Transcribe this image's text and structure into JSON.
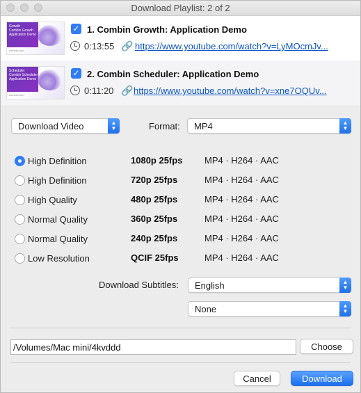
{
  "window": {
    "title": "Download Playlist: 2 of 2"
  },
  "playlist": [
    {
      "thumb_caption": "Growth",
      "thumb_text": "Combin Growth Application Demo",
      "thumb_site": "combin.com",
      "checked": true,
      "title": "1. Combin Growth: Application Demo",
      "duration": "0:13:55",
      "url": "https://www.youtube.com/watch?v=LyMOcmJv..."
    },
    {
      "thumb_caption": "Scheduler",
      "thumb_text": "Combin Scheduler Application Demo",
      "thumb_site": "combin.com",
      "checked": true,
      "title": "2. Combin Scheduler: Application Demo",
      "duration": "0:11:20",
      "url": "https://www.youtube.com/watch?v=xne7OQUv..."
    }
  ],
  "options": {
    "mode": "Download Video",
    "format_label": "Format:",
    "format": "MP4"
  },
  "qualities": [
    {
      "label": "High Definition",
      "resolution": "1080p 25fps",
      "codec": "MP4 · H264 · AAC",
      "selected": true
    },
    {
      "label": "High Definition",
      "resolution": "720p 25fps",
      "codec": "MP4 · H264 · AAC",
      "selected": false
    },
    {
      "label": "High Quality",
      "resolution": "480p 25fps",
      "codec": "MP4 · H264 · AAC",
      "selected": false
    },
    {
      "label": "Normal Quality",
      "resolution": "360p 25fps",
      "codec": "MP4 · H264 · AAC",
      "selected": false
    },
    {
      "label": "Normal Quality",
      "resolution": "240p 25fps",
      "codec": "MP4 · H264 · AAC",
      "selected": false
    },
    {
      "label": "Low Resolution",
      "resolution": "QCIF 25fps",
      "codec": "MP4 · H264 · AAC",
      "selected": false
    }
  ],
  "subtitles": {
    "label": "Download Subtitles:",
    "language": "English",
    "secondary": "None"
  },
  "destination": {
    "path": "/Volumes/Mac mini/4kvddd",
    "choose_label": "Choose"
  },
  "footer": {
    "cancel_label": "Cancel",
    "download_label": "Download"
  },
  "colors": {
    "accent": "#2e7cf6",
    "link": "#0b55c9",
    "window_bg": "#ececec"
  }
}
